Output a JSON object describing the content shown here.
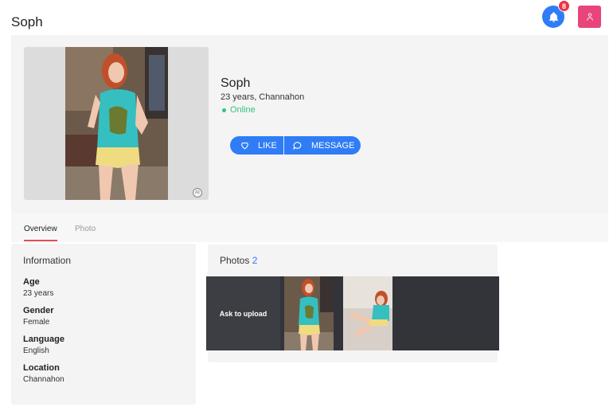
{
  "header": {
    "title": "Soph",
    "notifications_count": "8"
  },
  "profile": {
    "name": "Soph",
    "subtitle": "23 years, Channahon",
    "status": "Online",
    "ai_label": "AI",
    "actions": {
      "like": "LIKE",
      "message": "MESSAGE"
    }
  },
  "tabs": [
    {
      "label": "Overview",
      "active": true
    },
    {
      "label": "Photo",
      "active": false
    }
  ],
  "information": {
    "title": "Information",
    "fields": [
      {
        "label": "Age",
        "value": "23 years"
      },
      {
        "label": "Gender",
        "value": "Female"
      },
      {
        "label": "Language",
        "value": "English"
      },
      {
        "label": "Location",
        "value": "Channahon"
      }
    ]
  },
  "photos": {
    "title": "Photos",
    "count": "2",
    "ask_upload": "Ask to upload"
  },
  "colors": {
    "accent": "#2f7cf6",
    "online": "#33c27f",
    "tab_underline": "#e84c5a",
    "avatar_bg": "#e8457a"
  }
}
